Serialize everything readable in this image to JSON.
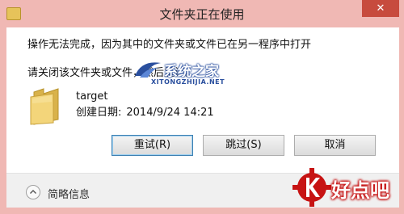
{
  "window": {
    "title": "文件夹正在使用",
    "close_glyph": "✕"
  },
  "dialog": {
    "message": "操作无法完成，因为其中的文件夹或文件已在另一程序中打开",
    "instruction": "请关闭该文件夹或文件，然后重试。",
    "file": {
      "name": "target",
      "date_label": "创建日期:",
      "date_value": "2014/9/24 14:21"
    },
    "buttons": {
      "retry": "重试(R)",
      "skip": "跳过(S)",
      "cancel": "取消"
    },
    "details_label": "简略信息"
  },
  "watermarks": {
    "site_zh": "系统之家",
    "site_en": "XITONGZHIJIA.NET",
    "brand": "好点吧"
  },
  "colors": {
    "frame": "#f0b8b4",
    "close_button": "#c74b3e",
    "brand_red": "#c71313",
    "site_blue": "#2a4f9e",
    "folder": "#e6c35a"
  }
}
